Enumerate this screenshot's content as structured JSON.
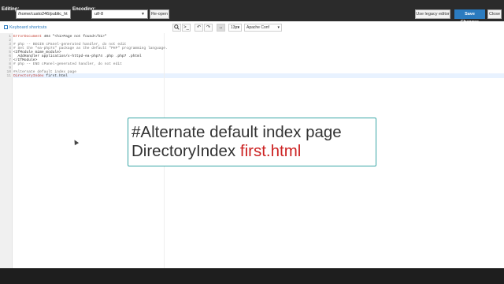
{
  "topbar": {
    "editing_label": "Editing:",
    "path_value": "/home/custo246/public_ht",
    "encoding_label": "Encoding:",
    "encoding_value": "utf-8",
    "reopen_label": "Re-open",
    "legacy_label": "Use legacy editor",
    "save_label": "Save Changes",
    "close_label": "Close"
  },
  "toolbar": {
    "keyboard_shortcuts": "Keyboard shortcuts",
    "search_icon": "search-icon",
    "terminal_icon": ">_",
    "undo_icon": "↶",
    "redo_icon": "↷",
    "wrap_icon": "↔",
    "font_size": "13px",
    "mode": "Apache Conf"
  },
  "editor": {
    "lines": [
      {
        "num": "1",
        "text": "ErrorDocument 404 \"<h1>Page not found</h1>\""
      },
      {
        "num": "2",
        "text": ""
      },
      {
        "num": "3",
        "text": "# php -- BEGIN cPanel-generated handler, do not edit"
      },
      {
        "num": "4",
        "text": "# Set the \"ea-php74\" package as the default \"PHP\" programming language."
      },
      {
        "num": "5",
        "text": "<IfModule mime_module>"
      },
      {
        "num": "6",
        "text": "  AddHandler application/x-httpd-ea-php74 .php .php7 .phtml"
      },
      {
        "num": "7",
        "text": "</IfModule>"
      },
      {
        "num": "8",
        "text": "# php -- END cPanel-generated handler, do not edit"
      },
      {
        "num": "9",
        "text": ""
      },
      {
        "num": "10",
        "text": "#Alternate default index page"
      },
      {
        "num": "11",
        "text": "DirectoryIndex first.html"
      }
    ]
  },
  "zoom": {
    "line1": "#Alternate default index page",
    "line2_directive": "DirectoryIndex",
    "line2_value": "first.html"
  },
  "colors": {
    "accent": "#2b7bbf",
    "directive_red": "#cc2222",
    "overlay_border": "#3aa6a6"
  }
}
